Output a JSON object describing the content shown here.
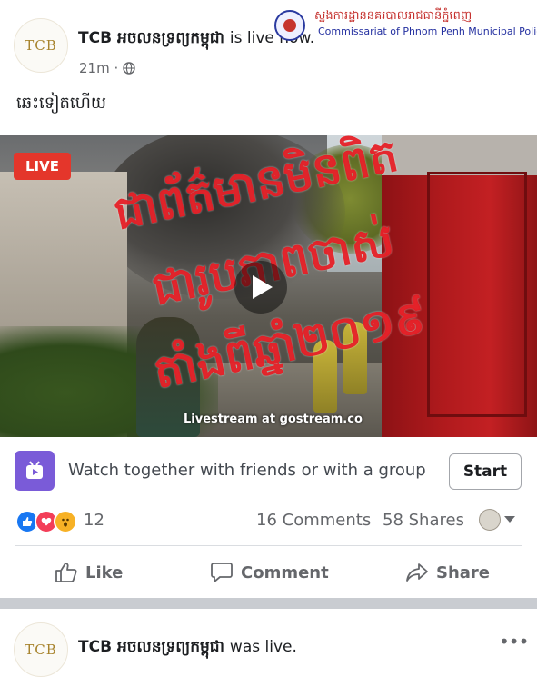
{
  "post": {
    "avatar_logo": "TCB",
    "page_name": "TCB អចលនទ្រព្យកម្ពុជា",
    "status": "is live now.",
    "time": "21m ·",
    "text": "ឆេះទៀតហើយ",
    "watermark": {
      "khmer": "ស្នងការដ្ឋាននគរបាលរាជធានីភ្នំពេញ",
      "english": "Commissariat of Phnom Penh Municipal Police"
    }
  },
  "video": {
    "live_badge": "LIVE",
    "caption": "Livestream at gostream.co",
    "stamp_lines": [
      "ជាព័ត៌មានមិនពិត",
      "ជារូបភាពចាស់",
      "តាំងពីឆ្នាំ២០១៩"
    ],
    "stamp_color": "#e4141c"
  },
  "watch_together": {
    "text": "Watch together with friends or with a group",
    "button": "Start",
    "icon": "watch-party-icon"
  },
  "reactions": {
    "types": [
      "like",
      "love",
      "wow"
    ],
    "count": "12",
    "comments": "16 Comments",
    "shares": "58 Shares"
  },
  "actions": {
    "like": "Like",
    "comment": "Comment",
    "share": "Share"
  },
  "next_post": {
    "avatar_logo": "TCB",
    "page_name": "TCB អចលនទ្រព្យកម្ពុជា",
    "status": "was live."
  },
  "colors": {
    "brand_blue": "#1877f2",
    "live_red": "#e4362b",
    "secondary_text": "#65676b",
    "logo_gold": "#a8842e"
  }
}
